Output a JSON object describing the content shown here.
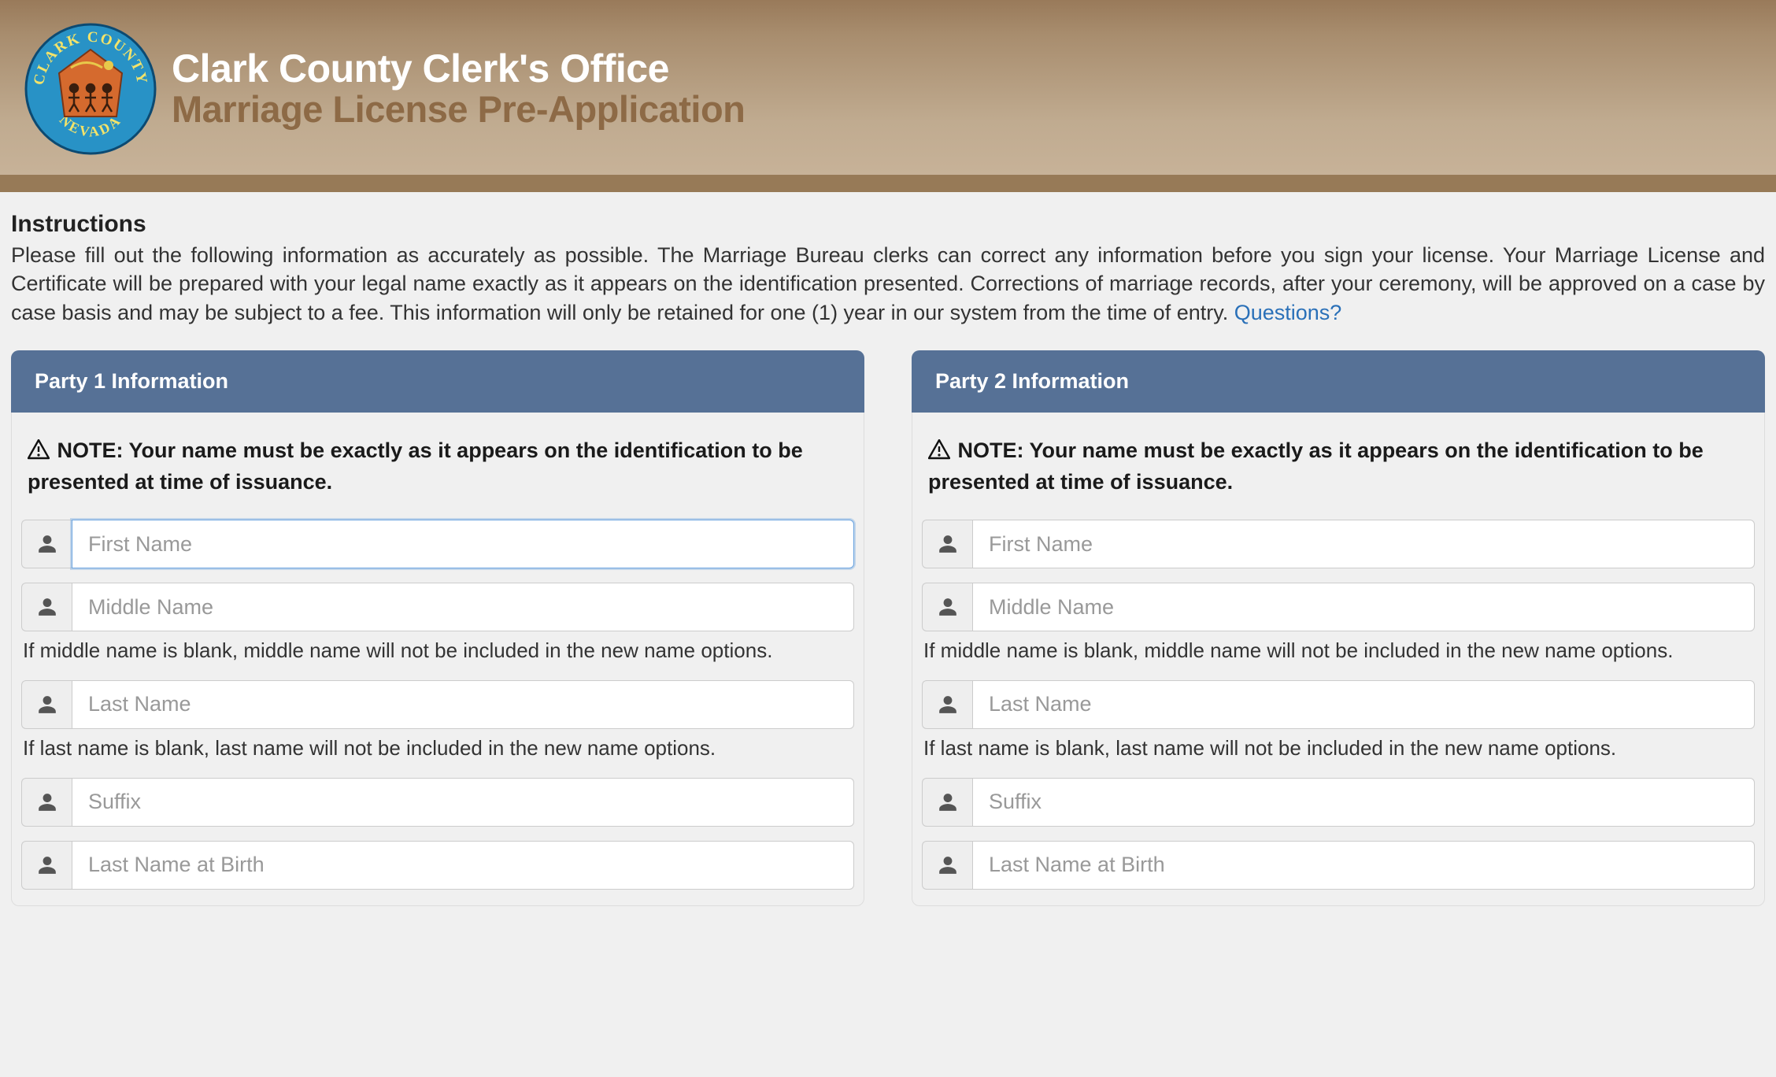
{
  "header": {
    "title": "Clark County Clerk's Office",
    "subtitle": "Marriage License Pre-Application",
    "seal_top_text": "CLARK COUNTY",
    "seal_bottom_text": "NEVADA"
  },
  "instructions": {
    "heading": "Instructions",
    "body": "Please fill out the following information as accurately as possible. The Marriage Bureau clerks can correct any information before you sign your license. Your Marriage License and Certificate will be prepared with your legal name exactly as it appears on the identification presented. Corrections of marriage records, after your ceremony, will be approved on a case by case basis and may be subject to a fee. This information will only be retained for one (1) year in our system from the time of entry. ",
    "link_text": "Questions?"
  },
  "party1": {
    "header": "Party 1 Information",
    "note_label": "NOTE:",
    "note_body": "Your name must be exactly as it appears on the identification to be presented at time of issuance.",
    "fields": {
      "first_name_placeholder": "First Name",
      "middle_name_placeholder": "Middle Name",
      "middle_help": "If middle name is blank, middle name will not be included in the new name options.",
      "last_name_placeholder": "Last Name",
      "last_help": "If last name is blank, last name will not be included in the new name options.",
      "suffix_placeholder": "Suffix",
      "last_name_birth_placeholder": "Last Name at Birth"
    }
  },
  "party2": {
    "header": "Party 2 Information",
    "note_label": "NOTE:",
    "note_body": "Your name must be exactly as it appears on the identification to be presented at time of issuance.",
    "fields": {
      "first_name_placeholder": "First Name",
      "middle_name_placeholder": "Middle Name",
      "middle_help": "If middle name is blank, middle name will not be included in the new name options.",
      "last_name_placeholder": "Last Name",
      "last_help": "If last name is blank, last name will not be included in the new name options.",
      "suffix_placeholder": "Suffix",
      "last_name_birth_placeholder": "Last Name at Birth"
    }
  }
}
